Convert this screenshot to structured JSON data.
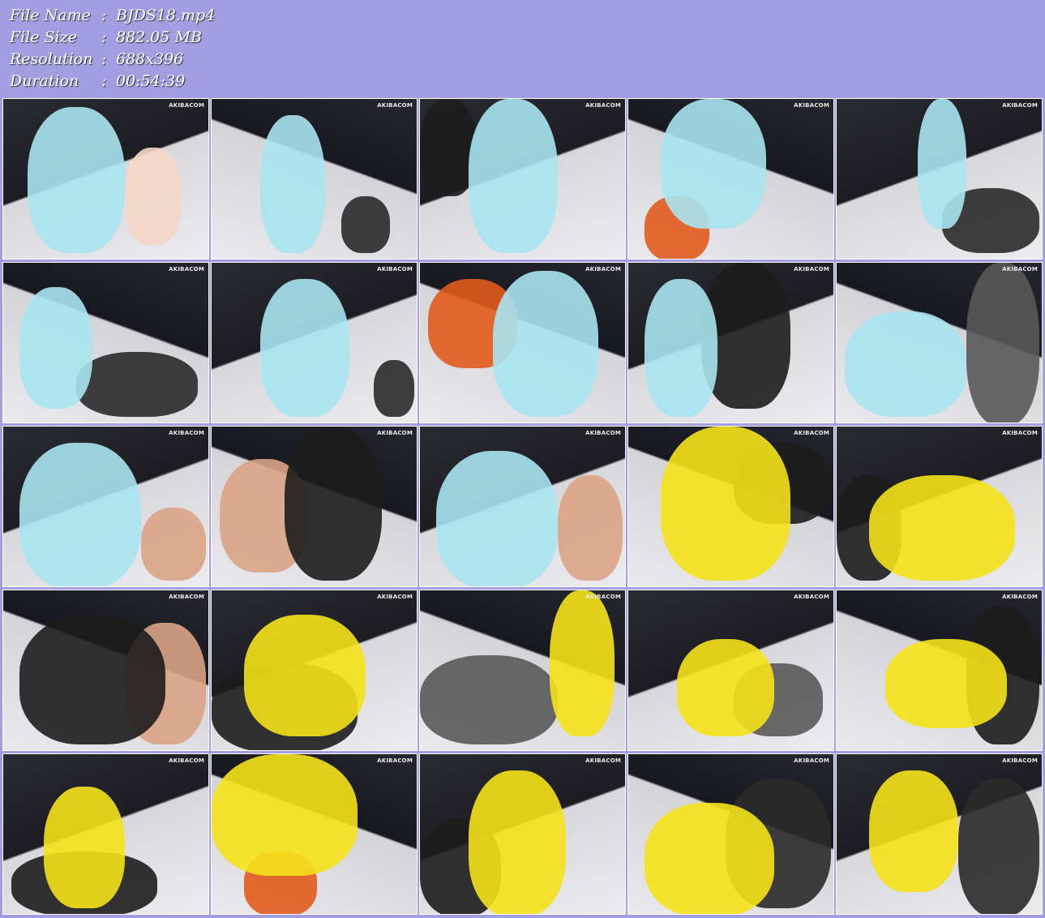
{
  "meta": [
    {
      "label": "File Name",
      "value": "BJDS18.mp4"
    },
    {
      "label": "File Size",
      "value": "882.05 MB"
    },
    {
      "label": "Resolution",
      "value": "688x396"
    },
    {
      "label": "Duration",
      "value": "00:54:39"
    }
  ],
  "separator": ":",
  "watermark": "AKIBACOM",
  "thumbnails": [
    {
      "suit": "#a9e4ef",
      "second": "#f4d6c8"
    },
    {
      "suit": "#a9e4ef",
      "second": "#2a2a2a"
    },
    {
      "suit": "#a9e4ef",
      "second": "#1d1d1d"
    },
    {
      "suit": "#a9e4ef",
      "second": "#e25b1e"
    },
    {
      "suit": "#a9e4ef",
      "second": "#2a2a2a"
    },
    {
      "suit": "#a9e4ef",
      "second": "#2a2a2a"
    },
    {
      "suit": "#a9e4ef",
      "second": "#2a2a2a"
    },
    {
      "suit": "#a9e4ef",
      "second": "#e25b1e"
    },
    {
      "suit": "#a9e4ef",
      "second": "#1d1d1d"
    },
    {
      "suit": "#a9e4ef",
      "second": "#595959"
    },
    {
      "suit": "#a9e4ef",
      "second": "#d9a385"
    },
    {
      "suit": "#1d1d1d",
      "second": "#d9a385"
    },
    {
      "suit": "#a9e4ef",
      "second": "#d9a385"
    },
    {
      "suit": "#f5e21a",
      "second": "#1d1d1d"
    },
    {
      "suit": "#f5e21a",
      "second": "#1d1d1d"
    },
    {
      "suit": "#1d1d1d",
      "second": "#d9a385"
    },
    {
      "suit": "#f5e21a",
      "second": "#1d1d1d"
    },
    {
      "suit": "#f5e21a",
      "second": "#595959"
    },
    {
      "suit": "#f5e21a",
      "second": "#595959"
    },
    {
      "suit": "#f5e21a",
      "second": "#1d1d1d"
    },
    {
      "suit": "#f5e21a",
      "second": "#1d1d1d"
    },
    {
      "suit": "#f5e21a",
      "second": "#e25b1e"
    },
    {
      "suit": "#f5e21a",
      "second": "#1d1d1d"
    },
    {
      "suit": "#f5e21a",
      "second": "#2a2a2a"
    },
    {
      "suit": "#f5e21a",
      "second": "#2a2a2a"
    }
  ]
}
